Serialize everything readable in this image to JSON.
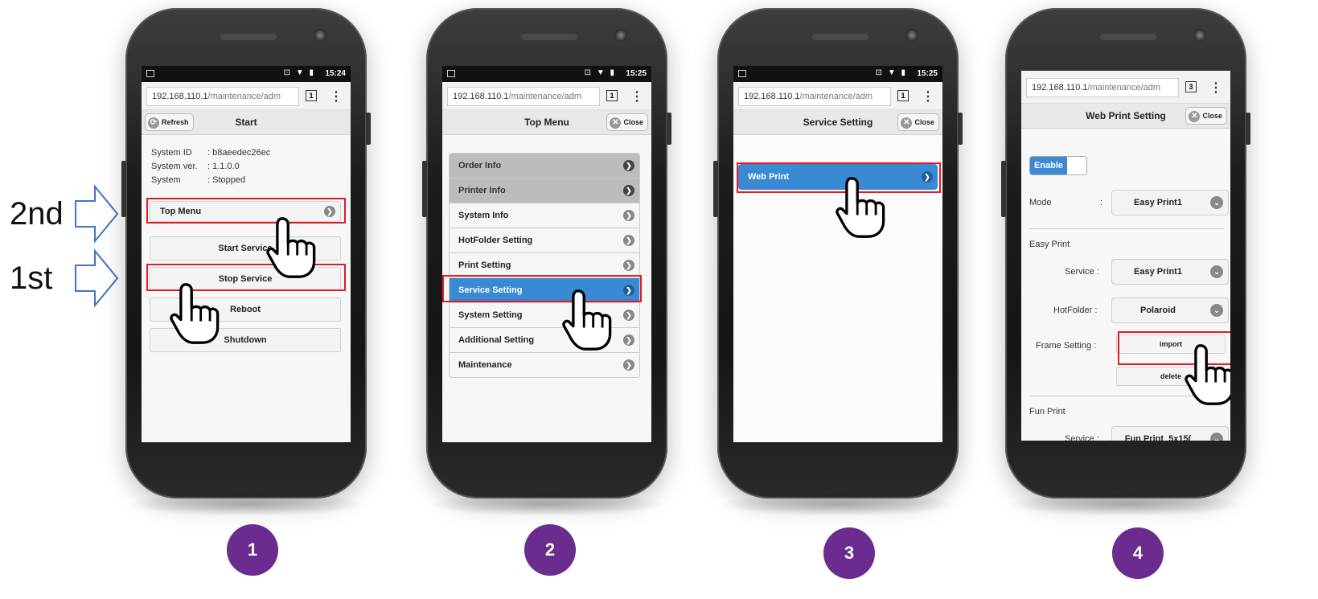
{
  "annotations": {
    "second_label": "2nd",
    "first_label": "1st"
  },
  "steps": [
    "1",
    "2",
    "3",
    "4"
  ],
  "colors": {
    "highlight": "#e21b26",
    "selected": "#3a8ad3",
    "step_circle": "#6a2c8f",
    "arrow_outline": "#4472c4"
  },
  "phone1": {
    "status": {
      "time": "15:24",
      "icons": "⊡ ▼ ▮"
    },
    "browser": {
      "url_host": "192.168.110.1",
      "url_path": "/maintenance/adm",
      "tab_count": "1",
      "menu_icon": "⋮"
    },
    "header": {
      "refresh_label": "Refresh",
      "title": "Start"
    },
    "info": {
      "system_id_label": "System ID",
      "system_id": ": b8aeedec26ec",
      "system_ver_label": "System ver.",
      "system_ver": ": 1.1.0.0",
      "system_label": "System",
      "system": ": Stopped"
    },
    "top_menu_label": "Top Menu",
    "buttons": {
      "start": "Start Service",
      "stop": "Stop Service",
      "reboot": "Reboot",
      "shutdown": "Shutdown"
    }
  },
  "phone2": {
    "status": {
      "time": "15:25",
      "icons": "⊡ ▼ ▮"
    },
    "browser": {
      "url_host": "192.168.110.1",
      "url_path": "/maintenance/adm",
      "tab_count": "1",
      "menu_icon": "⋮"
    },
    "header": {
      "title": "Top Menu",
      "close_label": "Close"
    },
    "menu": [
      {
        "label": "Order Info",
        "state": "disabled"
      },
      {
        "label": "Printer Info",
        "state": "disabled"
      },
      {
        "label": "System Info",
        "state": "normal"
      },
      {
        "label": "HotFolder Setting",
        "state": "normal"
      },
      {
        "label": "Print Setting",
        "state": "normal"
      },
      {
        "label": "Service Setting",
        "state": "selected"
      },
      {
        "label": "System Setting",
        "state": "normal"
      },
      {
        "label": "Additional Setting",
        "state": "normal"
      },
      {
        "label": "Maintenance",
        "state": "normal"
      }
    ]
  },
  "phone3": {
    "status": {
      "time": "15:25",
      "icons": "⊡ ▼ ▮"
    },
    "browser": {
      "url_host": "192.168.110.1",
      "url_path": "/maintenance/adm",
      "tab_count": "1",
      "menu_icon": "⋮"
    },
    "header": {
      "title": "Service Setting",
      "close_label": "Close"
    },
    "web_print_label": "Web Print"
  },
  "phone4": {
    "browser": {
      "url_host": "192.168.110.1",
      "url_path": "/maintenance/adm",
      "tab_count": "3",
      "menu_icon": "⋮"
    },
    "header": {
      "title": "Web Print Setting",
      "close_label": "Close"
    },
    "enable_label": "Enable",
    "mode_label": "Mode",
    "mode_colon": ":",
    "mode_value": "Easy Print1",
    "easy_print_heading": "Easy Print",
    "service_label": "Service :",
    "service_value": "Easy Print1",
    "hotfolder_label": "HotFolder :",
    "hotfolder_value": "Polaroid",
    "frame_label": "Frame Setting :",
    "import_label": "import",
    "delete_label": "delete",
    "fun_print_heading": "Fun Print",
    "fun_service_label": "Service :",
    "fun_service_value": "Fun Print_5x15("
  }
}
